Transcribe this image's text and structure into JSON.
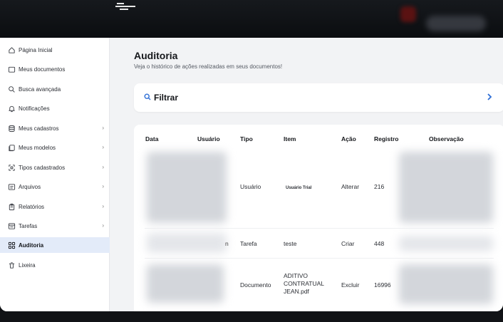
{
  "sidebar": {
    "items": [
      {
        "label": "Página Inicial",
        "icon": "home-icon",
        "has_chevron": false,
        "active": false
      },
      {
        "label": "Meus documentos",
        "icon": "folder-icon",
        "has_chevron": false,
        "active": false
      },
      {
        "label": "Busca avançada",
        "icon": "search-icon",
        "has_chevron": false,
        "active": false
      },
      {
        "label": "Notificações",
        "icon": "bell-icon",
        "has_chevron": false,
        "active": false
      },
      {
        "label": "Meus cadastros",
        "icon": "database-icon",
        "has_chevron": true,
        "active": false
      },
      {
        "label": "Meus modelos",
        "icon": "copy-icon",
        "has_chevron": true,
        "active": false
      },
      {
        "label": "Tipos cadastrados",
        "icon": "scan-icon",
        "has_chevron": true,
        "active": false
      },
      {
        "label": "Arquivos",
        "icon": "archive-icon",
        "has_chevron": true,
        "active": false
      },
      {
        "label": "Relatórios",
        "icon": "clipboard-icon",
        "has_chevron": true,
        "active": false
      },
      {
        "label": "Tarefas",
        "icon": "tasks-icon",
        "has_chevron": true,
        "active": false
      },
      {
        "label": "Auditoria",
        "icon": "grid-icon",
        "has_chevron": false,
        "active": true
      },
      {
        "label": "Lixeira",
        "icon": "trash-icon",
        "has_chevron": false,
        "active": false
      }
    ],
    "chevron": "›"
  },
  "page": {
    "title": "Auditoria",
    "subtitle": "Veja o histórico de ações realizadas em seus documentos!"
  },
  "filter": {
    "label": "Filtrar"
  },
  "table": {
    "headers": [
      "Data",
      "Usuário",
      "Tipo",
      "Item",
      "Ação",
      "Registro",
      "Observação"
    ],
    "rows": [
      {
        "tipo": "Usuário",
        "item": "Usuário Trial",
        "acao": "Alterar",
        "registro": "216"
      },
      {
        "tipo": "Tarefa",
        "item": "teste",
        "acao": "Criar",
        "registro": "448"
      },
      {
        "tipo": "Documento",
        "item": "ADITIVO CONTRATUAL JEAN.pdf",
        "acao": "Excluir",
        "registro": "16996"
      }
    ],
    "partial_user_char": "n"
  },
  "colors": {
    "accent": "#2f6fd6",
    "active_bg": "#e3ebf9",
    "page_bg": "#f2f3f5"
  }
}
